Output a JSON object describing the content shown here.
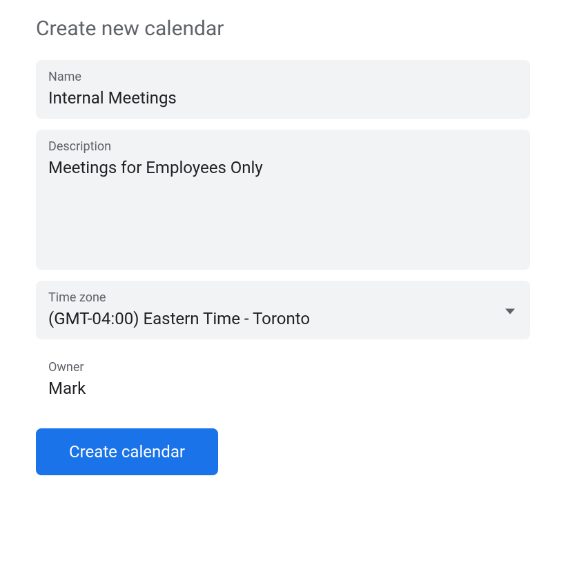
{
  "title": "Create new calendar",
  "fields": {
    "name": {
      "label": "Name",
      "value": "Internal Meetings"
    },
    "description": {
      "label": "Description",
      "value": "Meetings for Employees Only"
    },
    "timezone": {
      "label": "Time zone",
      "value": "(GMT-04:00) Eastern Time - Toronto"
    },
    "owner": {
      "label": "Owner",
      "value": "Mark"
    }
  },
  "button": {
    "create_label": "Create calendar"
  }
}
